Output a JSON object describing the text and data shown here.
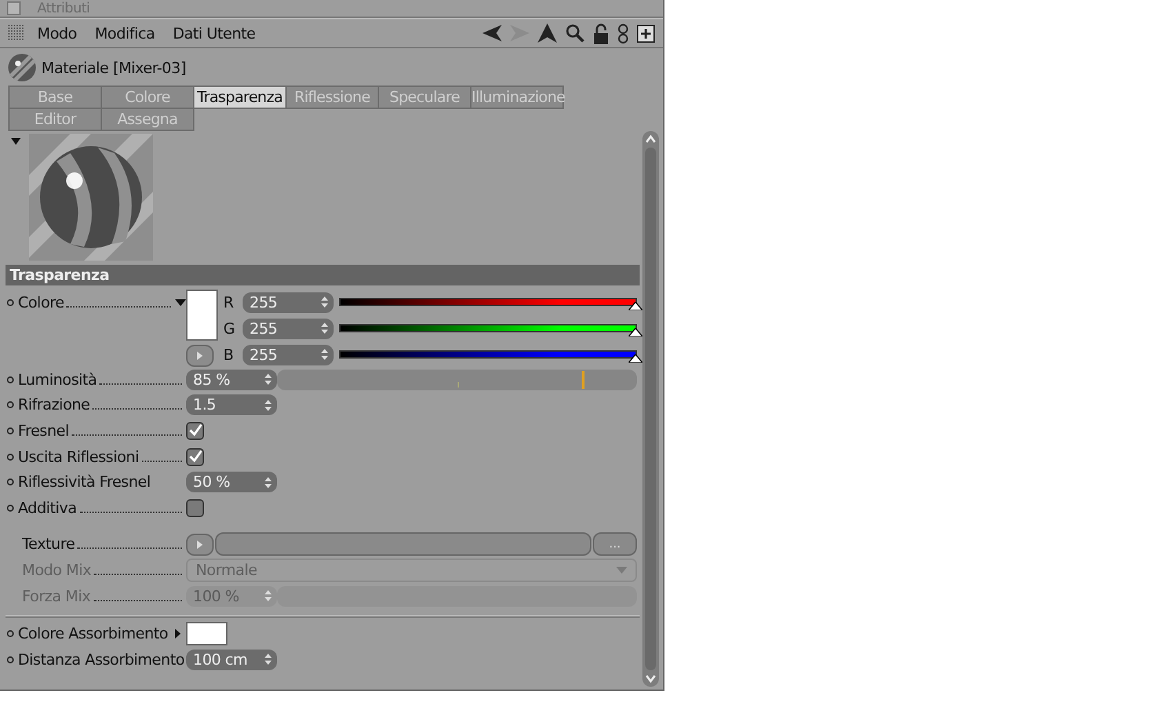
{
  "window": {
    "title": "Attributi"
  },
  "menu": [
    "Modo",
    "Modifica",
    "Dati Utente"
  ],
  "material": {
    "title": "Materiale [Mixer-03]"
  },
  "tabs": [
    [
      {
        "label": "Base",
        "selected": false
      },
      {
        "label": "Colore",
        "selected": false
      },
      {
        "label": "Trasparenza",
        "selected": true
      },
      {
        "label": "Riflessione",
        "selected": false
      },
      {
        "label": "Speculare",
        "selected": false
      },
      {
        "label": "Illuminazione",
        "selected": false
      }
    ],
    [
      {
        "label": "Editor",
        "selected": false
      },
      {
        "label": "Assegna",
        "selected": false
      }
    ]
  ],
  "section": {
    "title": "Trasparenza"
  },
  "color": {
    "label": "Colore",
    "channels": [
      {
        "name": "R",
        "value": "255",
        "level": 1,
        "color": "#ff0000"
      },
      {
        "name": "G",
        "value": "255",
        "level": 1,
        "color": "#00ff00"
      },
      {
        "name": "B",
        "value": "255",
        "level": 1,
        "color": "#0000ff"
      }
    ]
  },
  "rows": [
    {
      "kind": "slider",
      "label": "Luminosità",
      "value": "85 %",
      "level": 0.85,
      "disabled": false
    },
    {
      "kind": "number",
      "label": "Rifrazione",
      "value": "1.5",
      "disabled": false
    },
    {
      "kind": "checkbox",
      "label": "Fresnel",
      "checked": true,
      "disabled": false
    },
    {
      "kind": "checkbox",
      "label": "Uscita Riflessioni",
      "checked": true,
      "disabled": false
    },
    {
      "kind": "number",
      "label": "Riflessività Fresnel",
      "value": "50 %",
      "disabled": false
    },
    {
      "kind": "checkbox",
      "label": "Additiva",
      "checked": false,
      "disabled": false
    },
    {
      "kind": "texture",
      "label": "Texture",
      "button": "...",
      "disabled": false
    },
    {
      "kind": "dropdown",
      "label": "Modo Mix",
      "value": "Normale",
      "disabled": true
    },
    {
      "kind": "slider",
      "label": "Forza Mix",
      "value": "100 %",
      "disabled": true
    },
    {
      "kind": "separator"
    },
    {
      "kind": "swatch",
      "label": "Colore Assorbimento",
      "color": "#ffffff",
      "disabled": false
    },
    {
      "kind": "number",
      "label": "Distanza Assorbimento",
      "value": "100 cm",
      "disabled": false
    }
  ]
}
